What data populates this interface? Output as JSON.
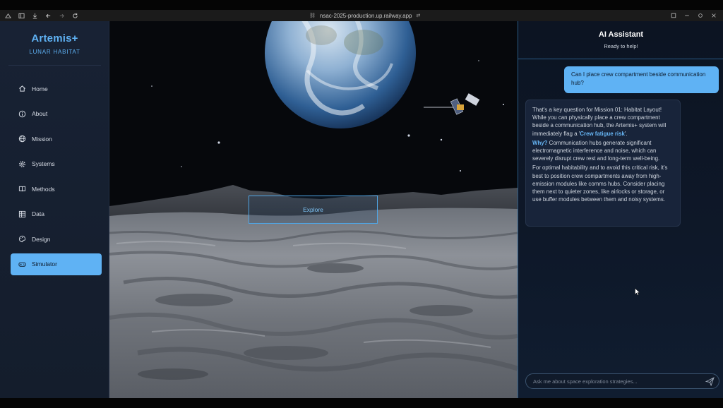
{
  "browser": {
    "url": "nsac-2025-production.up.railway.app"
  },
  "sidebar": {
    "brand_title": "Artemis+",
    "brand_subtitle": "LUNAR HABITAT",
    "items": [
      {
        "label": "Home",
        "icon": "home-icon"
      },
      {
        "label": "About",
        "icon": "info-icon"
      },
      {
        "label": "Mission",
        "icon": "globe-icon"
      },
      {
        "label": "Systems",
        "icon": "gear-icon"
      },
      {
        "label": "Methods",
        "icon": "book-icon"
      },
      {
        "label": "Data",
        "icon": "table-icon"
      },
      {
        "label": "Design",
        "icon": "palette-icon"
      },
      {
        "label": "Simulator",
        "icon": "gamepad-icon",
        "active": true
      }
    ]
  },
  "scene": {
    "explore_label": "Explore"
  },
  "assistant": {
    "title": "AI Assistant",
    "subtitle": "Ready to help!",
    "user_message": "Can I place crew compartment beside communication hub?",
    "ai_p1_prefix": "That's a key question for Mission 01: Habitat Layout! While you can physically place a crew compartment beside a communication hub, the Artemis+ system will immediately flag a '",
    "ai_p1_highlight": "Crew fatigue risk",
    "ai_p1_suffix": "'.",
    "ai_p2_label": "Why?",
    "ai_p2_text": " Communication hubs generate significant electromagnetic interference and noise, which can severely disrupt crew rest and long-term well-being.",
    "ai_p3": "For optimal habitability and to avoid this critical risk, it's best to position crew compartments away from high-emission modules like comms hubs. Consider placing them next to quieter zones, like airlocks or storage, or use buffer modules between them and noisy systems.",
    "input_placeholder": "Ask me about space exploration strategies..."
  },
  "colors": {
    "accent": "#5fb2f4",
    "sidebar_bg": "#182234",
    "panel_bg": "#0e1829"
  }
}
